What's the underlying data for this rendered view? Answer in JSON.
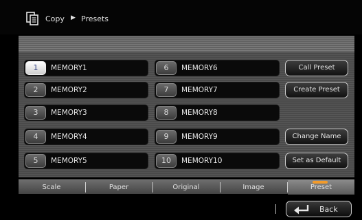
{
  "breadcrumb": {
    "parent": "Copy",
    "separator": "▶",
    "current": "Presets"
  },
  "memories": [
    {
      "num": "1",
      "label": "MEMORY1"
    },
    {
      "num": "2",
      "label": "MEMORY2"
    },
    {
      "num": "3",
      "label": "MEMORY3"
    },
    {
      "num": "4",
      "label": "MEMORY4"
    },
    {
      "num": "5",
      "label": "MEMORY5"
    },
    {
      "num": "6",
      "label": "MEMORY6"
    },
    {
      "num": "7",
      "label": "MEMORY7"
    },
    {
      "num": "8",
      "label": "MEMORY8"
    },
    {
      "num": "9",
      "label": "MEMORY9"
    },
    {
      "num": "10",
      "label": "MEMORY10"
    }
  ],
  "actions": {
    "call_preset": "Call Preset",
    "create_preset": "Create Preset",
    "change_name": "Change Name",
    "set_default": "Set as Default"
  },
  "tabs": [
    {
      "label": "Scale"
    },
    {
      "label": "Paper"
    },
    {
      "label": "Original"
    },
    {
      "label": "Image"
    },
    {
      "label": "Preset"
    }
  ],
  "back": {
    "label": "Back"
  },
  "colors": {
    "active_tab_indicator": "#f39b2a",
    "selected_number_text": "#3a4a8a"
  },
  "icons": {
    "header": "copy-document-icon",
    "back": "return-arrow-icon"
  }
}
